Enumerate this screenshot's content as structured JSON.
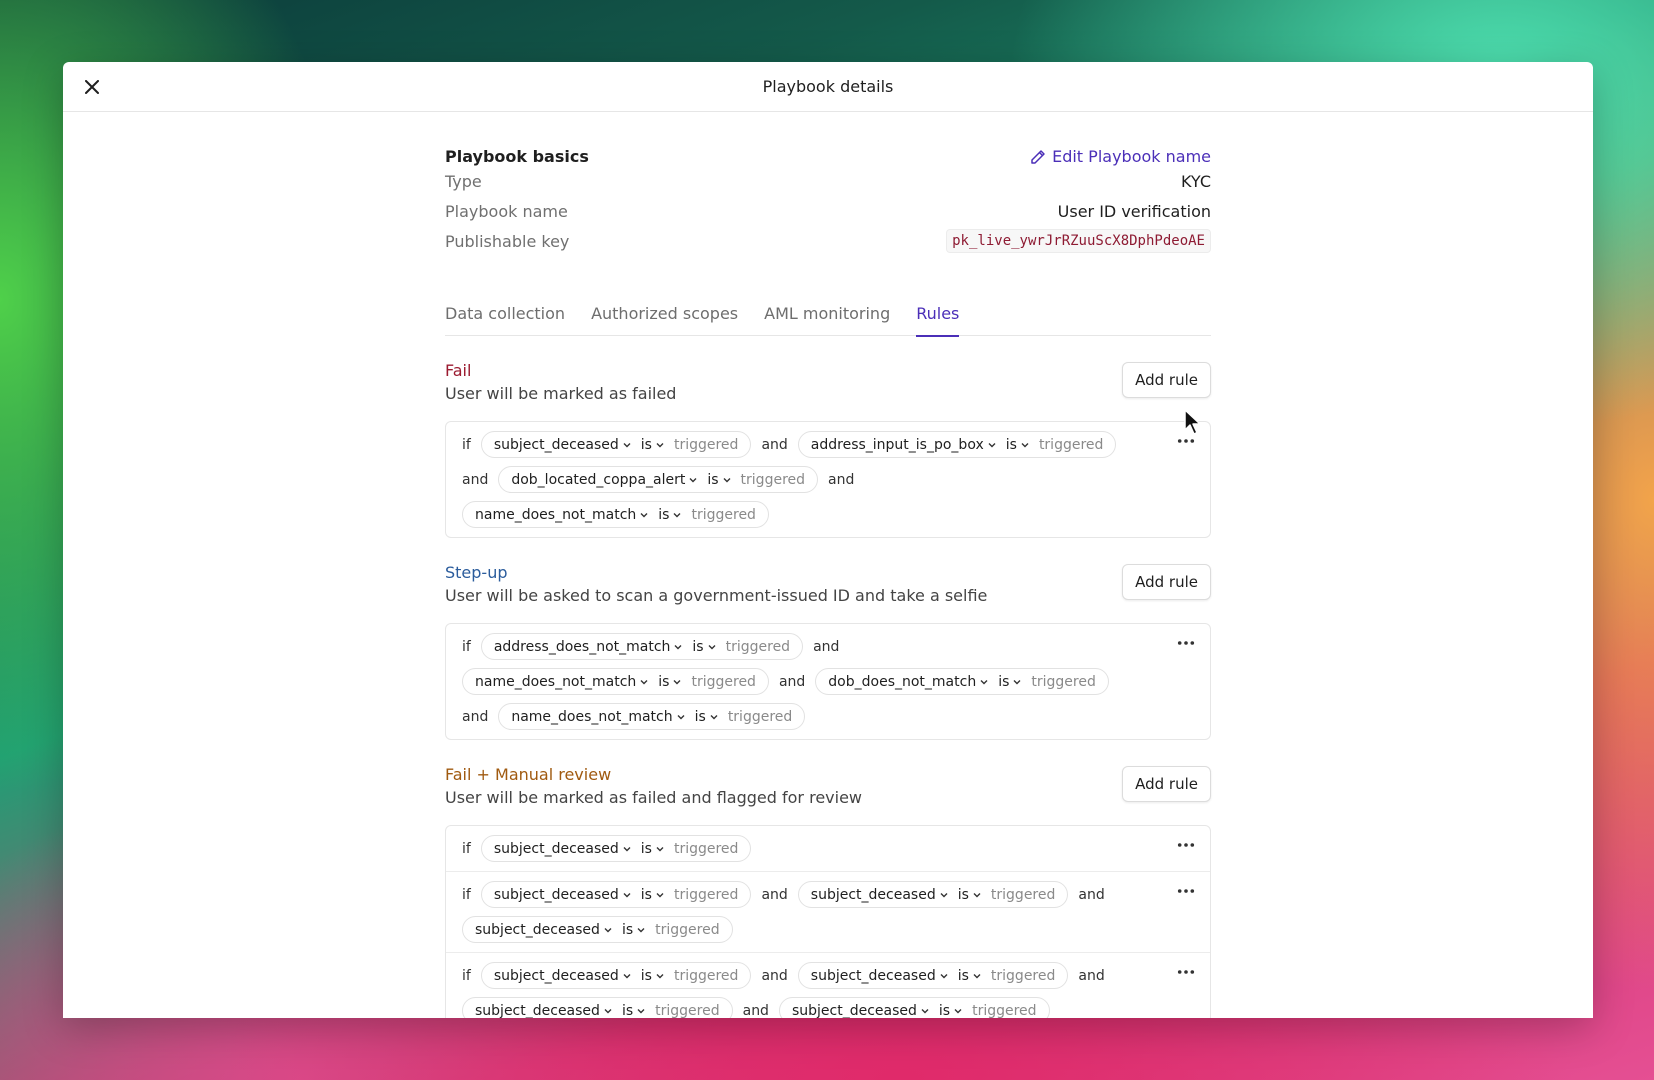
{
  "modal": {
    "title": "Playbook details"
  },
  "basics": {
    "title": "Playbook basics",
    "edit_label": "Edit Playbook name",
    "rows": [
      {
        "label": "Type",
        "value": "KYC"
      },
      {
        "label": "Playbook name",
        "value": "User ID verification"
      },
      {
        "label": "Publishable key",
        "value": "pk_live_ywrJrRZuuScX8DphPdeoAE"
      }
    ]
  },
  "tabs": [
    {
      "label": "Data collection",
      "active": false
    },
    {
      "label": "Authorized scopes",
      "active": false
    },
    {
      "label": "AML monitoring",
      "active": false
    },
    {
      "label": "Rules",
      "active": true
    }
  ],
  "add_rule_label": "Add rule",
  "colors": {
    "accent": "#4b2fb8",
    "fail": "#9b1b30",
    "stepup": "#2b5c9c",
    "manual_review": "#a05a10"
  },
  "groups": [
    {
      "name": "Fail",
      "color": "#9b1b30",
      "desc": "User will be marked as failed",
      "rules": [
        [
          {
            "kw": "if"
          },
          {
            "field": "subject_deceased",
            "op": "is",
            "value": "triggered"
          },
          {
            "kw": "and"
          },
          {
            "field": "address_input_is_po_box",
            "op": "is",
            "value": "triggered"
          },
          {
            "kw": "and"
          },
          {
            "field": "dob_located_coppa_alert",
            "op": "is",
            "value": "triggered"
          },
          {
            "kw": "and"
          },
          {
            "field": "name_does_not_match",
            "op": "is",
            "value": "triggered"
          }
        ]
      ]
    },
    {
      "name": "Step-up",
      "color": "#2b5c9c",
      "desc": "User will be asked to scan a government-issued ID and take a selfie",
      "rules": [
        [
          {
            "kw": "if"
          },
          {
            "field": "address_does_not_match",
            "op": "is",
            "value": "triggered"
          },
          {
            "kw": "and"
          },
          {
            "field": "name_does_not_match",
            "op": "is",
            "value": "triggered"
          },
          {
            "kw": "and"
          },
          {
            "field": "dob_does_not_match",
            "op": "is",
            "value": "triggered"
          },
          {
            "kw": "and"
          },
          {
            "field": "name_does_not_match",
            "op": "is",
            "value": "triggered"
          }
        ]
      ]
    },
    {
      "name": "Fail + Manual review",
      "color": "#a05a10",
      "desc": "User will be marked as failed and flagged for review",
      "rules": [
        [
          {
            "kw": "if"
          },
          {
            "field": "subject_deceased",
            "op": "is",
            "value": "triggered"
          }
        ],
        [
          {
            "kw": "if"
          },
          {
            "field": "subject_deceased",
            "op": "is",
            "value": "triggered"
          },
          {
            "kw": "and"
          },
          {
            "field": "subject_deceased",
            "op": "is",
            "value": "triggered"
          },
          {
            "kw": "and"
          },
          {
            "field": "subject_deceased",
            "op": "is",
            "value": "triggered"
          }
        ],
        [
          {
            "kw": "if"
          },
          {
            "field": "subject_deceased",
            "op": "is",
            "value": "triggered"
          },
          {
            "kw": "and"
          },
          {
            "field": "subject_deceased",
            "op": "is",
            "value": "triggered"
          },
          {
            "kw": "and"
          },
          {
            "field": "subject_deceased",
            "op": "is",
            "value": "triggered"
          },
          {
            "kw": "and"
          },
          {
            "field": "subject_deceased",
            "op": "is",
            "value": "triggered"
          }
        ]
      ]
    }
  ]
}
